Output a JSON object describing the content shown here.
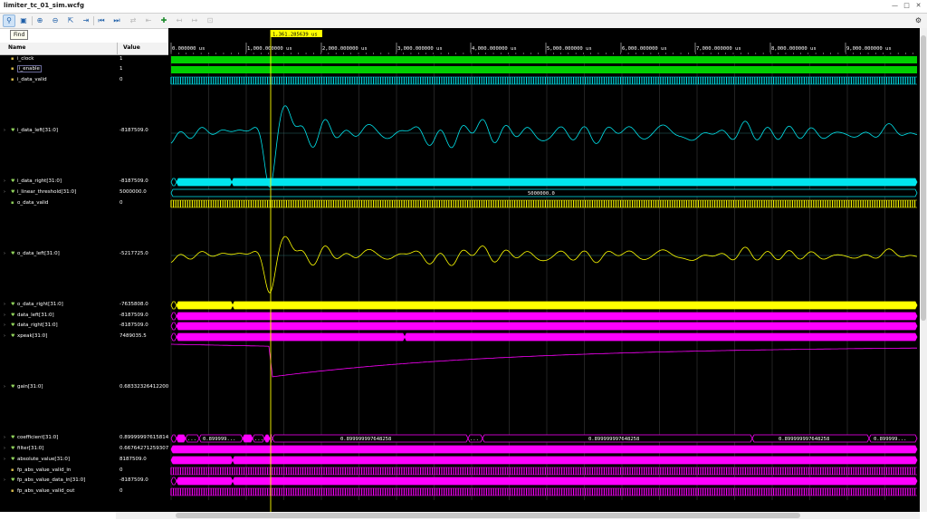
{
  "window": {
    "title": "limiter_tc_01_sim.wcfg"
  },
  "tooltip": "Find",
  "columns": {
    "name": "Name",
    "value": "Value"
  },
  "cursor": {
    "label": "1,361.285639 us"
  },
  "timeline": {
    "labels": [
      "0.000000 us",
      "1,000.000000 us",
      "2,000.000000 us",
      "3,000.000000 us",
      "4,000.000000 us",
      "5,000.000000 us",
      "6,000.000000 us",
      "7,000.000000 us",
      "8,000.000000 us",
      "9,000.000000 us"
    ]
  },
  "signals": [
    {
      "name": "i_clock",
      "value": "1",
      "icon": "bit-icon",
      "expand": false
    },
    {
      "name": "i_enable",
      "value": "1",
      "icon": "bit-icon",
      "expand": false
    },
    {
      "name": "i_data_valid",
      "value": "0",
      "icon": "bit-icon",
      "expand": false
    },
    {
      "name": "i_data_left[31:0]",
      "value": "-8187509.0",
      "icon": "bus-icon",
      "expand": true
    },
    {
      "name": "i_data_right[31:0]",
      "value": "-8187509.0",
      "icon": "bus-icon",
      "expand": true
    },
    {
      "name": "i_linear_threshold[31:0]",
      "value": "5000000.0",
      "icon": "bus-icon",
      "expand": true
    },
    {
      "name": "o_data_valid",
      "value": "0",
      "icon": "bit-icon",
      "expand": false
    },
    {
      "name": "o_data_left[31:0]",
      "value": "-5217725.0",
      "icon": "bus-icon",
      "expand": true
    },
    {
      "name": "o_data_right[31:0]",
      "value": "-7635808.0",
      "icon": "bus-icon",
      "expand": true
    },
    {
      "name": "data_left[31:0]",
      "value": "-8187509.0",
      "icon": "bus-icon",
      "expand": true
    },
    {
      "name": "data_right[31:0]",
      "value": "-8187509.0",
      "icon": "bus-icon",
      "expand": true
    },
    {
      "name": "xpeak[31:0]",
      "value": "7489035.5",
      "icon": "bus-icon",
      "expand": true
    },
    {
      "name": "gain[31:0]",
      "value": "0.683323264122009",
      "icon": "bus-icon",
      "expand": true
    },
    {
      "name": "coefficient[31:0]",
      "value": "0.899999976158142",
      "icon": "bus-icon",
      "expand": true
    },
    {
      "name": "filter[31:0]",
      "value": "0.667642712593079",
      "icon": "bus-icon",
      "expand": true
    },
    {
      "name": "absolute_value[31:0]",
      "value": "8187509.0",
      "icon": "bus-icon",
      "expand": true
    },
    {
      "name": "fp_abs_value_valid_in",
      "value": "0",
      "icon": "bit-icon",
      "expand": false
    },
    {
      "name": "fp_abs_value_data_in[31:0]",
      "value": "-8187509.0",
      "icon": "bus-icon",
      "expand": true
    },
    {
      "name": "fp_abs_value_valid_out",
      "value": "0",
      "icon": "bit-icon",
      "expand": false
    }
  ],
  "bus_values": {
    "threshold": "5000000.0",
    "coefficient": "0.899999997648258",
    "coefficient_short": "0.899999...",
    "ellipsis": "..."
  },
  "colors": {
    "green": "#00d000",
    "cyan": "#00e5ee",
    "yellow": "#ffff00",
    "magenta": "#ff00ff",
    "cursor": "#ffff00"
  }
}
